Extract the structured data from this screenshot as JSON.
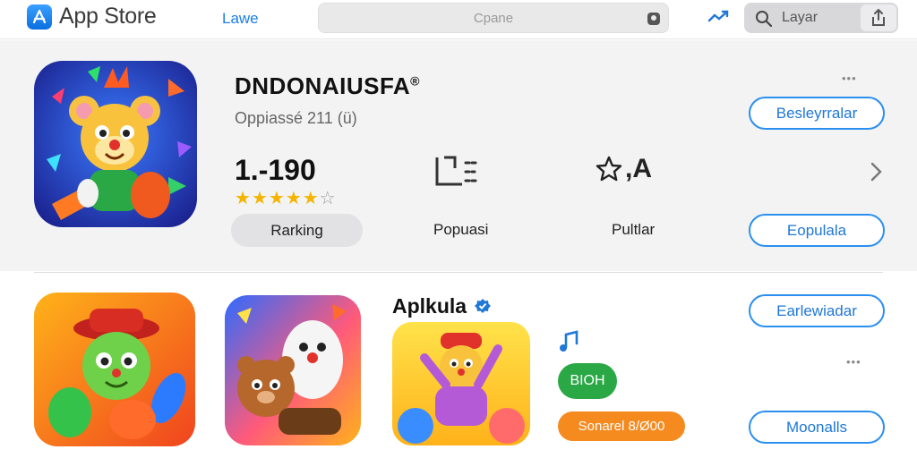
{
  "topbar": {
    "brand": "App Store",
    "tab_link": "Lawe",
    "search_placeholder": "Cpane",
    "search_query": "Layar"
  },
  "featured": {
    "title": "DNDONAIUSFA",
    "subtitle": "Oppiassé 211 (ü)",
    "stat_value": "1.-190",
    "rating_filled": 5,
    "rating_total": 6,
    "ranking_label": "Rarking",
    "popular_label": "Popuasi",
    "star_suffix": ",A",
    "pullar_label": "Pultlar",
    "top_button": "Beslеуrralar",
    "bottom_button": "Eopulala",
    "more_dots": "•••"
  },
  "lower": {
    "app_title": "Aplkula",
    "green_badge": "BIOH",
    "orange_badge": "Sonarel 8/Ø00",
    "button_1": "Earlewiadar",
    "button_2": "Moonalls",
    "more_dots": "•••"
  },
  "icons": {
    "brand": "app-store-icon",
    "verified": "verified-badge-icon",
    "music": "music-note-icon",
    "share": "share-icon",
    "search": "search-icon",
    "trending": "trending-icon"
  },
  "colors": {
    "accent": "#1f77d6",
    "star": "#f4b400",
    "green_badge": "#2aa845",
    "orange_badge": "#f58a1f"
  }
}
